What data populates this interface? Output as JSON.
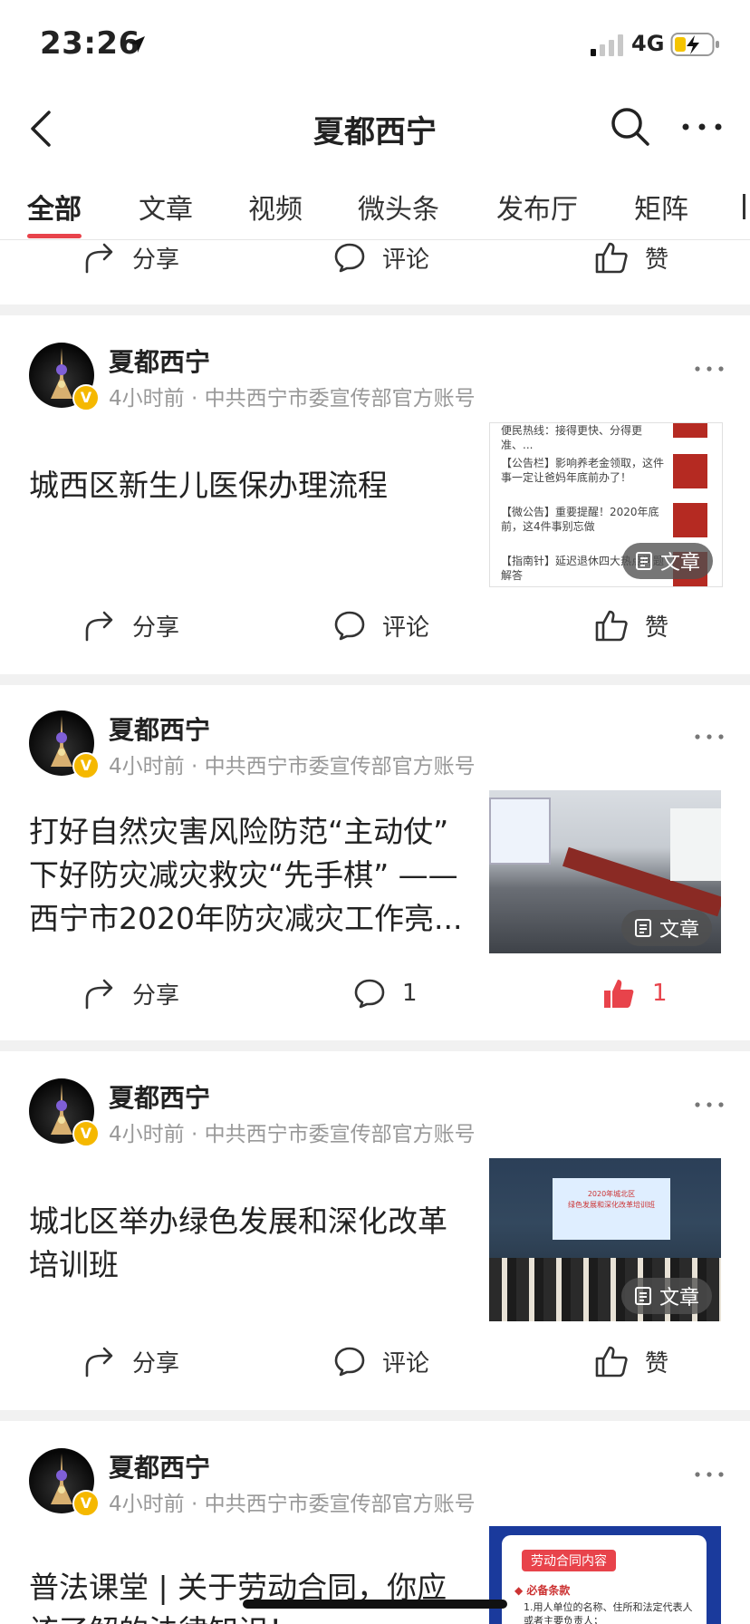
{
  "status_bar": {
    "time": "23:26",
    "network": "4G"
  },
  "header": {
    "title": "夏都西宁"
  },
  "tabs": [
    {
      "label": "全部",
      "active": true
    },
    {
      "label": "文章"
    },
    {
      "label": "视频"
    },
    {
      "label": "微头条"
    },
    {
      "label": "发布厅"
    },
    {
      "label": "矩阵"
    }
  ],
  "top_actions": {
    "share": "分享",
    "comment": "评论",
    "like": "赞"
  },
  "cards": [
    {
      "author": "夏都西宁",
      "meta": "4小时前 · 中共西宁市委宣传部官方账号",
      "headline": "城西区新生儿医保办理流程",
      "thumb_badge": "文章",
      "thumb_lines": [
        "便民热线：接得更快、分得更准、...",
        "【公告栏】影响养老金领取，这件事一定让爸妈年底前办了！",
        "【微公告】重要提醒！2020年底前，这4件事别忘做",
        "【指南针】延迟退休四大热点问题解答"
      ],
      "share": "分享",
      "comment": "评论",
      "like": "赞"
    },
    {
      "author": "夏都西宁",
      "meta": "4小时前 · 中共西宁市委宣传部官方账号",
      "headline": "打好自然灾害风险防范“主动仗” 下好防灾减灾救灾“先手棋” ——西宁市2020年防灾减灾工作亮...",
      "thumb_badge": "文章",
      "share": "分享",
      "comment": "1",
      "like": "1"
    },
    {
      "author": "夏都西宁",
      "meta": "4小时前 · 中共西宁市委宣传部官方账号",
      "headline": "城北区举办绿色发展和深化改革培训班",
      "thumb_badge": "文章",
      "thumb_screen_text": [
        "2020年城北区",
        "绿色发展和深化改革培训班"
      ],
      "share": "分享",
      "comment": "评论",
      "like": "赞"
    },
    {
      "author": "夏都西宁",
      "meta": "4小时前 · 中共西宁市委宣传部官方账号",
      "headline": "普法课堂 | 关于劳动合同，你应该了解的法律知识！",
      "thumb_title": "劳动合同内容",
      "thumb_lines": [
        "◆ 必备条款",
        "1.用人单位的名称、住所和法定代表人或者主要负责人；"
      ]
    }
  ],
  "colors": {
    "accent": "#e8434b",
    "badge": "#f5b800"
  }
}
